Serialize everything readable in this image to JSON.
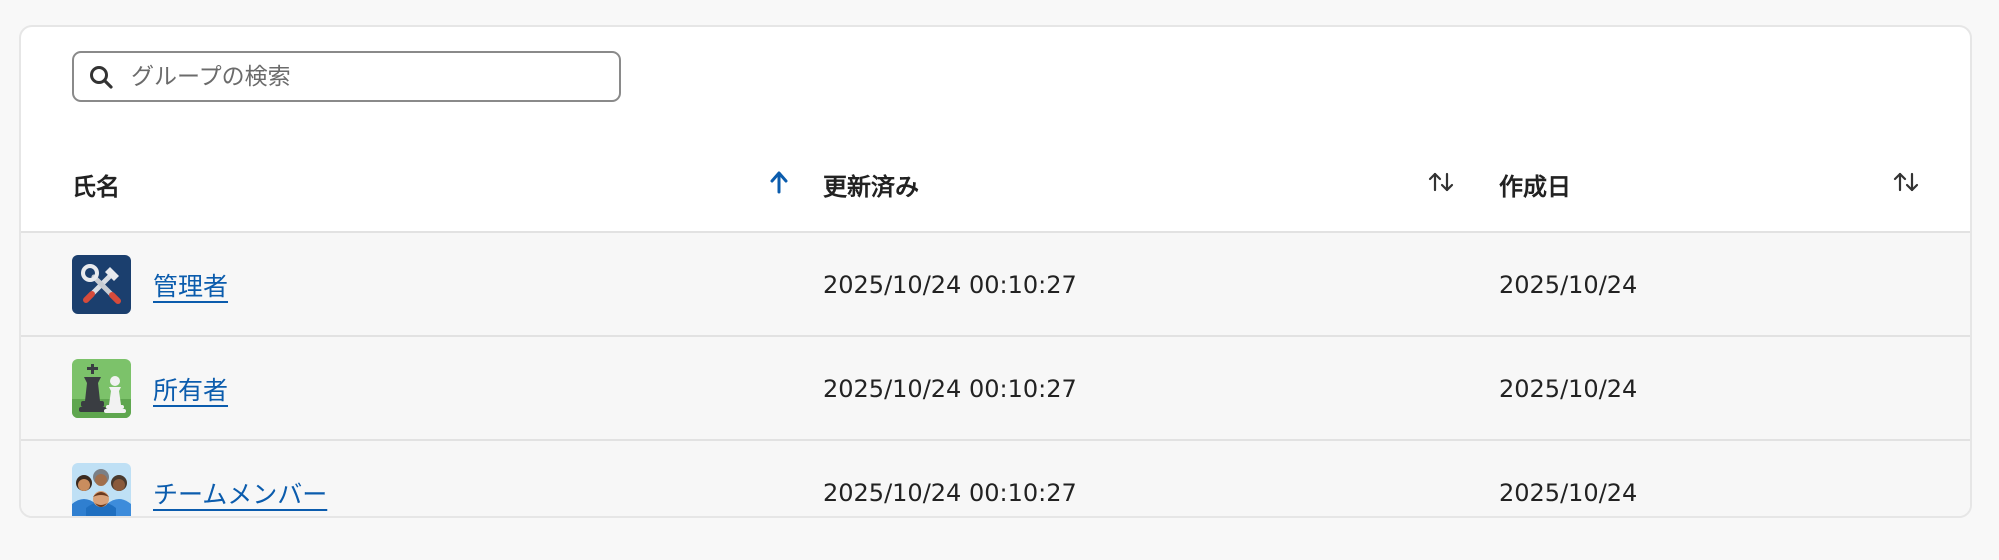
{
  "search": {
    "placeholder": "グループの検索",
    "value": ""
  },
  "table": {
    "columns": [
      {
        "label": "氏名",
        "sort": "ascending"
      },
      {
        "label": "更新済み",
        "sort": "none"
      },
      {
        "label": "作成日",
        "sort": "none"
      }
    ],
    "rows": [
      {
        "name": "管理者",
        "icon": "tools-icon",
        "updated": "2025/10/24 00:10:27",
        "created": "2025/10/24"
      },
      {
        "name": "所有者",
        "icon": "chess-icon",
        "updated": "2025/10/24 00:10:27",
        "created": "2025/10/24"
      },
      {
        "name": "チームメンバー",
        "icon": "team-icon",
        "updated": "2025/10/24 00:10:27",
        "created": "2025/10/24"
      }
    ]
  },
  "colors": {
    "link": "#0b5cad",
    "sort_active": "#0b5cad",
    "sort_inactive": "#333333",
    "row_background": "#f7f7f7"
  }
}
